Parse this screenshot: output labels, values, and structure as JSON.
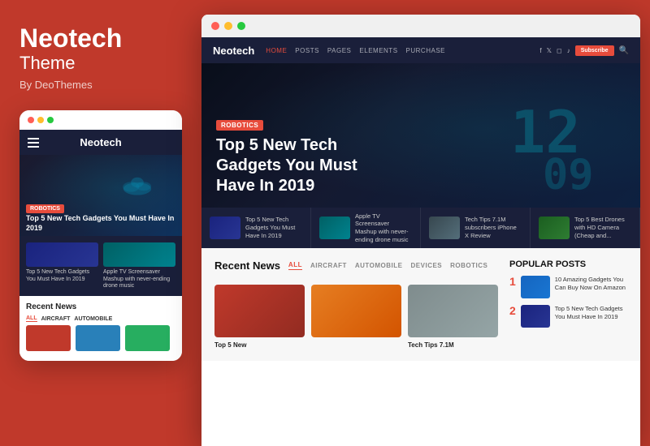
{
  "left": {
    "brand": "Neotech",
    "subtitle": "Theme",
    "by": "By DeoThemes",
    "mobile": {
      "nav_title": "Neotech",
      "robotics_badge": "ROBOTICS",
      "hero_text": "Top 5 New Tech Gadgets You Must Have In 2019",
      "thumb1": "Top 5 New Tech Gadgets You Must Have In 2019",
      "thumb2": "Apple TV Screensaver Mashup with never-ending drone music",
      "recent_news": "Recent News",
      "tabs": [
        "ALL",
        "AIRCRAFT",
        "AUTOMOBILE"
      ]
    }
  },
  "browser": {
    "dots": [
      "#ff5f56",
      "#ffbd2e",
      "#27c93f"
    ],
    "site_logo": "Neotech",
    "nav": [
      "HOME",
      "POSTS",
      "PAGES",
      "ELEMENTS",
      "PURCHASE"
    ],
    "subscribe": "Subscribe",
    "hero": {
      "badge": "ROBOTICS",
      "title": "Top 5 New Tech Gadgets You Must Have In 2019"
    },
    "thumbs": [
      {
        "text": "Top 5 New Tech Gadgets You Must Have In 2019"
      },
      {
        "text": "Apple TV Screensaver Mashup with never-ending drone music"
      },
      {
        "text": "Tech Tips 7.1M subscribers iPhone X Review"
      },
      {
        "text": "Top 5 Best Drones with HD Camera (Cheap and..."
      }
    ],
    "main": {
      "recent_news": "Recent News",
      "tabs": [
        "ALL",
        "AIRCRAFT",
        "AUTOMOBILE",
        "DEVICES",
        "ROBOTICS"
      ],
      "news_items": [
        {
          "label": "Top 5 New"
        },
        {
          "label": ""
        },
        {
          "label": "Tech Tips 7.1M"
        }
      ],
      "popular_title": "POPULAR POSTS",
      "popular": [
        {
          "num": "1",
          "text": "10 Amazing Gadgets You Can Buy Now On Amazon"
        },
        {
          "num": "2",
          "text": "Top 5 New Tech Gadgets You Must Have In 2019"
        }
      ]
    }
  }
}
